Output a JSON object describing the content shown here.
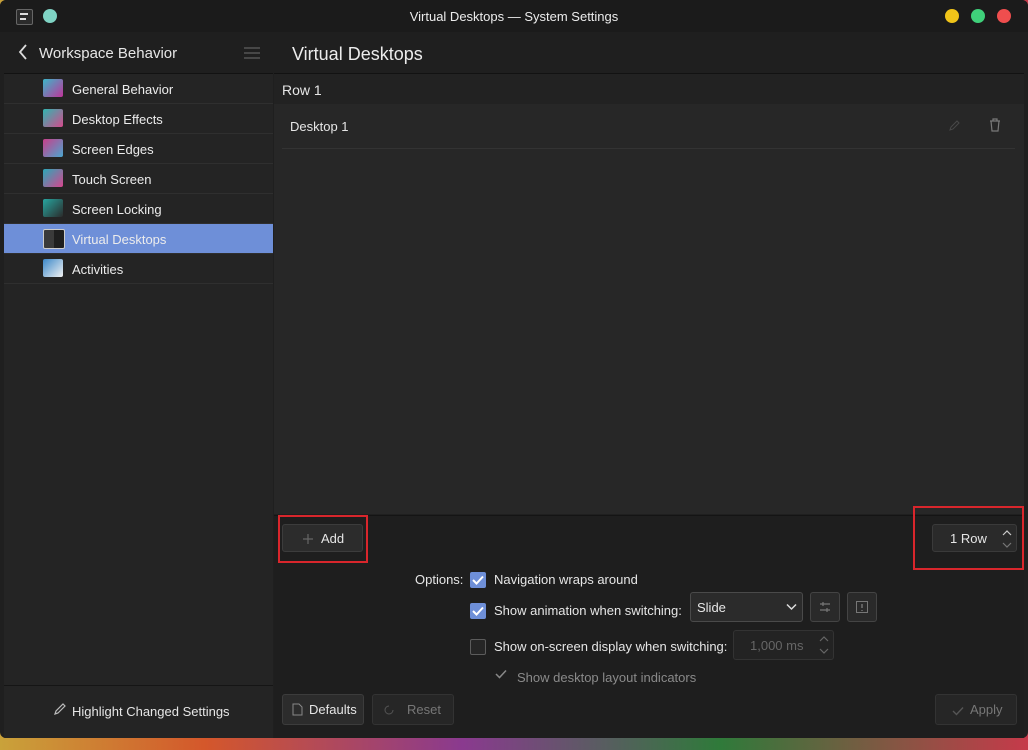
{
  "window": {
    "title": "Virtual Desktops — System Settings"
  },
  "titlebar": {
    "minimize_color": "#f0c419",
    "maximize_color": "#3fd07a",
    "close_color": "#ef4e4e"
  },
  "sidebar": {
    "header": "Workspace Behavior",
    "items": [
      {
        "label": "General Behavior",
        "icon": "general-behavior-icon",
        "active": false
      },
      {
        "label": "Desktop Effects",
        "icon": "desktop-effects-icon",
        "active": false
      },
      {
        "label": "Screen Edges",
        "icon": "screen-edges-icon",
        "active": false
      },
      {
        "label": "Touch Screen",
        "icon": "touch-screen-icon",
        "active": false
      },
      {
        "label": "Screen Locking",
        "icon": "screen-locking-icon",
        "active": false
      },
      {
        "label": "Virtual Desktops",
        "icon": "virtual-desktops-icon",
        "active": true
      },
      {
        "label": "Activities",
        "icon": "activities-icon",
        "active": false
      }
    ],
    "footer_label": "Highlight Changed Settings"
  },
  "main": {
    "title": "Virtual Desktops",
    "row_label": "Row 1",
    "desktops": [
      {
        "name": "Desktop 1"
      }
    ],
    "add_label": "Add",
    "rows_value": "1 Row",
    "options_label": "Options:",
    "nav_wrap_label": "Navigation wraps around",
    "nav_wrap_checked": true,
    "show_anim_label": "Show animation when switching:",
    "show_anim_checked": true,
    "anim_value": "Slide",
    "osd_label": "Show on-screen display when switching:",
    "osd_checked": false,
    "osd_duration": "1,000 ms",
    "layout_indicators_label": "Show desktop layout indicators",
    "defaults_label": "Defaults",
    "reset_label": "Reset",
    "apply_label": "Apply",
    "accent": "#6e8fd8",
    "highlight_color": "#d9262c"
  }
}
